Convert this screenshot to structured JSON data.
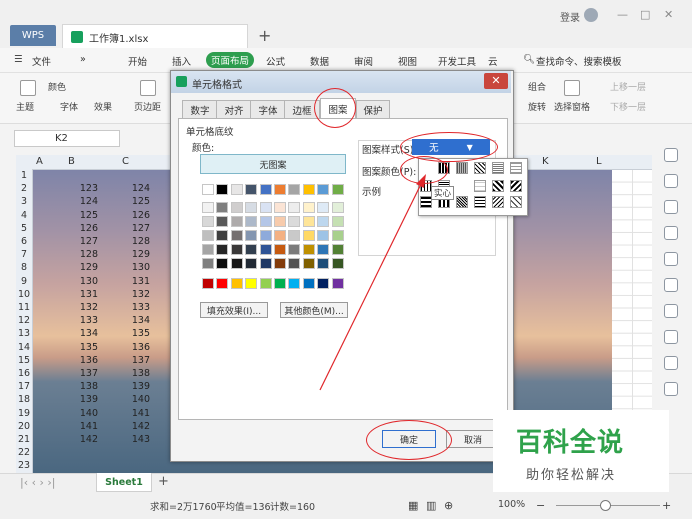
{
  "titlebar": {
    "app": "WPS",
    "doc": "工作簿1.xlsx",
    "login": "登录"
  },
  "menu": {
    "file": "文件",
    "items": [
      "开始",
      "插入",
      "页面布局",
      "公式",
      "数据",
      "审阅",
      "视图",
      "开发工具",
      "云"
    ],
    "search": "查找命令、搜索模板"
  },
  "ribbon": {
    "color": "颜色",
    "theme": "主题",
    "font": "字体",
    "effect": "效果",
    "margin": "页边距",
    "group": "组合",
    "rotate": "旋转",
    "select_pane": "选择窗格",
    "up": "上移一层",
    "down": "下移一层"
  },
  "formula": {
    "namebox": "K2"
  },
  "sheet": {
    "cols": [
      "A",
      "B",
      "C",
      "K",
      "L"
    ],
    "rows": [
      "1",
      "2",
      "3",
      "4",
      "5",
      "6",
      "7",
      "8",
      "9",
      "10",
      "11",
      "12",
      "13",
      "14",
      "15",
      "16",
      "17",
      "18",
      "19",
      "20",
      "21",
      "22",
      "23"
    ],
    "colB": [
      "123",
      "124",
      "125",
      "126",
      "127",
      "128",
      "129",
      "130",
      "131",
      "132",
      "133",
      "134",
      "135",
      "136",
      "137",
      "138",
      "139",
      "140",
      "141",
      "142"
    ],
    "colC": [
      "124",
      "125",
      "126",
      "127",
      "128",
      "129",
      "130",
      "131",
      "132",
      "133",
      "134",
      "135",
      "136",
      "137",
      "138",
      "139",
      "140",
      "141",
      "142",
      "143"
    ],
    "tab": "Sheet1"
  },
  "status": {
    "sum": "求和=2万1760",
    "avg": "平均值=136",
    "count": "计数=160",
    "zoom": "100%"
  },
  "dialog": {
    "title": "单元格格式",
    "tabs": [
      "数字",
      "对齐",
      "字体",
      "边框",
      "图案",
      "保护"
    ],
    "section": "单元格底纹",
    "color_label": "颜色:",
    "no_pattern": "无图案",
    "fill_effect": "填充效果(I)...",
    "other_color": "其他颜色(M)...",
    "pattern_style": "图案样式(S):",
    "pattern_value": "无",
    "pattern_color": "图案颜色(P):",
    "sample": "示例",
    "tooltip": "实心",
    "ok": "确定",
    "cancel": "取消"
  },
  "watermark": {
    "title": "百科全说",
    "sub": "助你轻松解决"
  },
  "colors": {
    "accent": "#2e9e4f",
    "red": "#e0272b"
  }
}
